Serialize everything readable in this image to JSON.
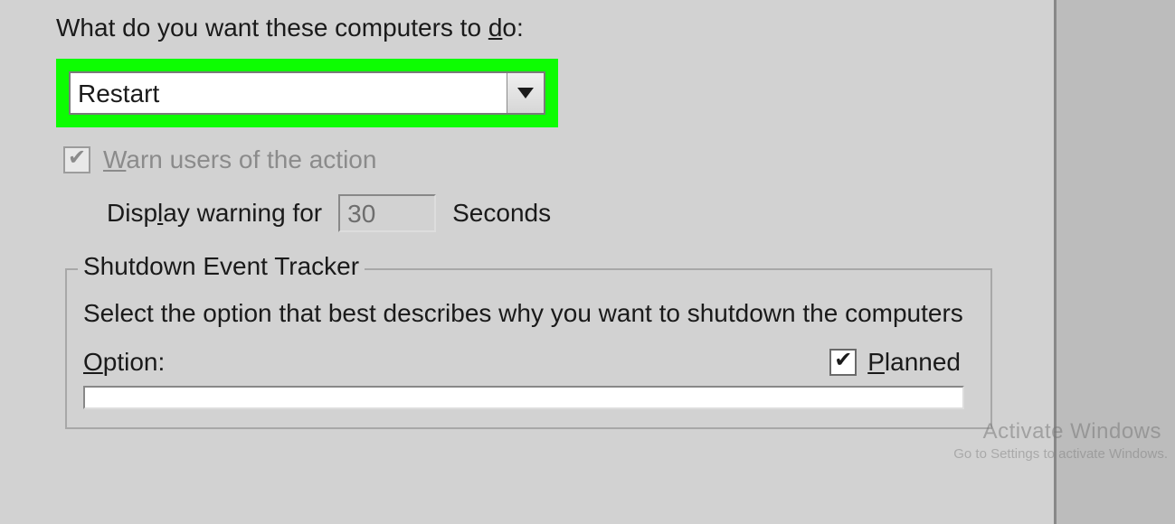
{
  "mainLabel": {
    "pre": "What do you want these computers to ",
    "mn": "d",
    "post": "o:"
  },
  "actionCombo": {
    "value": "Restart"
  },
  "warn": {
    "mn": "W",
    "post": "arn users of the action",
    "checked": true
  },
  "display": {
    "pre": "Disp",
    "mn": "l",
    "post": "ay warning for",
    "value": "30",
    "unit": "Seconds"
  },
  "tracker": {
    "legend": "Shutdown Event Tracker",
    "desc": "Select the option that best describes why you want to shutdown the computers",
    "optionLabel": {
      "mn": "O",
      "post": "ption:"
    },
    "planned": {
      "mn": "P",
      "post": "lanned",
      "checked": true
    }
  },
  "watermark": {
    "line1": "Activate Windows",
    "line2": "Go to Settings to activate Windows."
  }
}
